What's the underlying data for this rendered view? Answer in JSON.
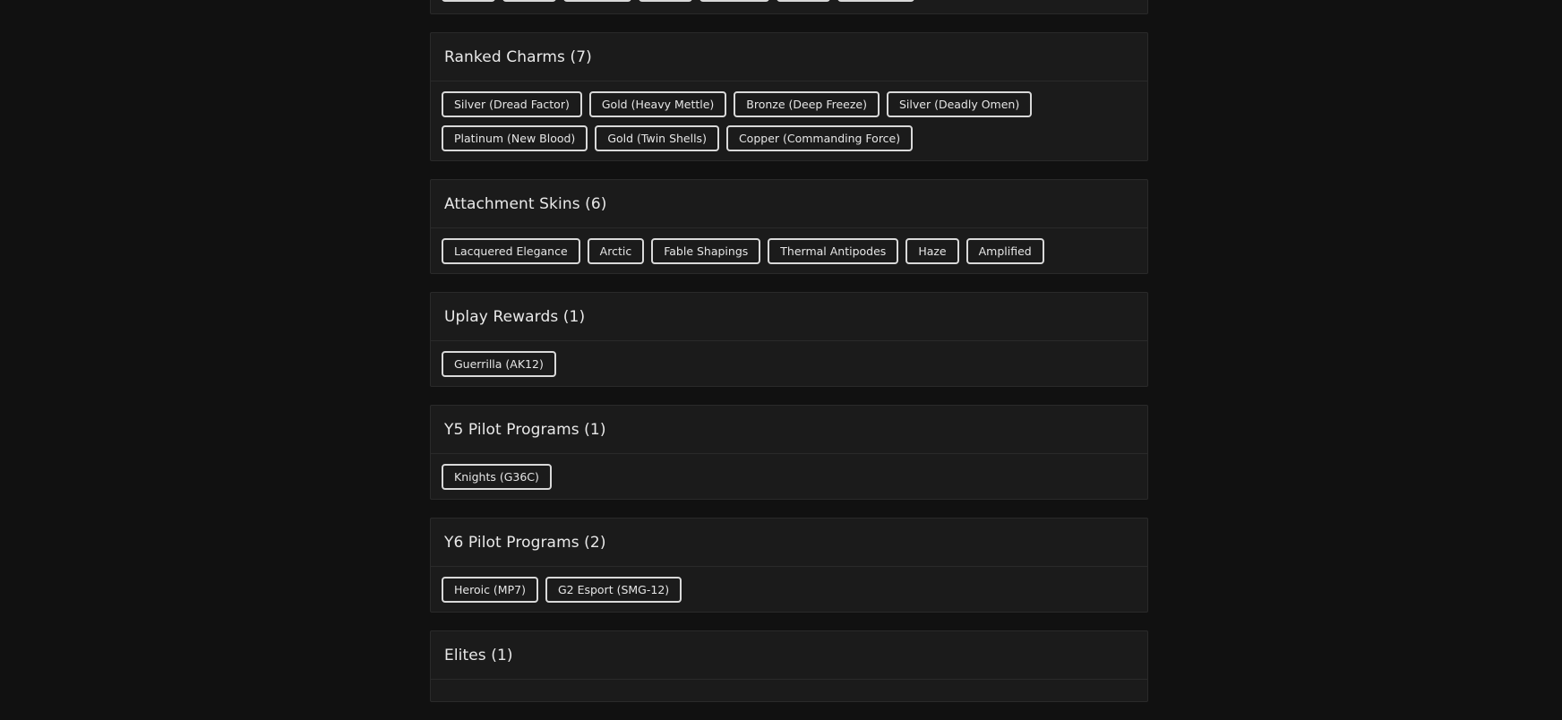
{
  "sections": [
    {
      "title": "Ranked Charms (7)",
      "items": [
        "Silver (Dread Factor)",
        "Gold (Heavy Mettle)",
        "Bronze (Deep Freeze)",
        "Silver (Deadly Omen)",
        "Platinum (New Blood)",
        "Gold (Twin Shells)",
        "Copper (Commanding Force)"
      ]
    },
    {
      "title": "Attachment Skins (6)",
      "items": [
        "Lacquered Elegance",
        "Arctic",
        "Fable Shapings",
        "Thermal Antipodes",
        "Haze",
        "Amplified"
      ]
    },
    {
      "title": "Uplay Rewards (1)",
      "items": [
        "Guerrilla (AK12)"
      ]
    },
    {
      "title": "Y5 Pilot Programs (1)",
      "items": [
        "Knights (G36C)"
      ]
    },
    {
      "title": "Y6 Pilot Programs (2)",
      "items": [
        "Heroic (MP7)",
        "G2 Esport (SMG-12)"
      ]
    },
    {
      "title": "Elites (1)",
      "items": []
    }
  ]
}
